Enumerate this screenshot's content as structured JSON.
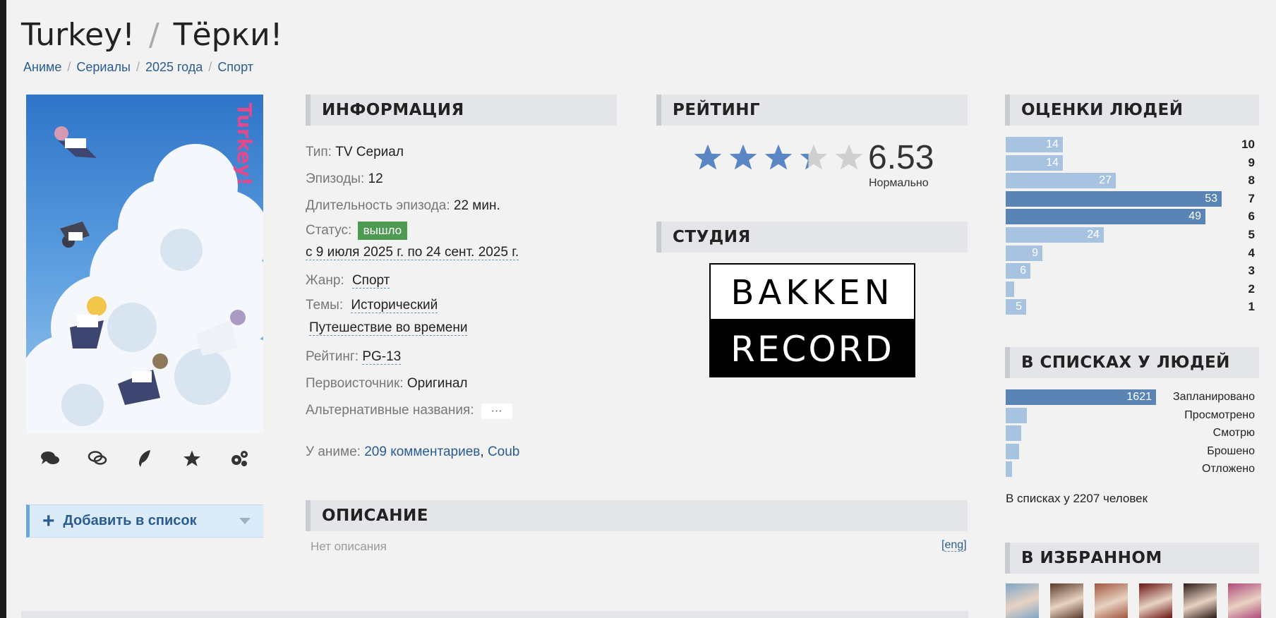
{
  "title": {
    "english": "Turkey!",
    "separator": "/",
    "russian": "Тёрки!"
  },
  "breadcrumbs": [
    "Аниме",
    "Сериалы",
    "2025 года",
    "Спорт"
  ],
  "poster": {
    "alt": "Turkey! poster"
  },
  "poster_actions": [
    "comments-icon",
    "discussion-icon",
    "review-icon",
    "favorite-star-icon",
    "settings-gears-icon"
  ],
  "add_to_list": {
    "plus": "+",
    "label": "Добавить в список"
  },
  "info": {
    "header": "ИНФОРМАЦИЯ",
    "type_key": "Тип:",
    "type_value": "TV Сериал",
    "episodes_key": "Эпизоды:",
    "episodes_value": "12",
    "duration_key": "Длительность эпизода:",
    "duration_value": "22 мин.",
    "status_key": "Статус:",
    "status_value": "вышло",
    "dates": "с 9 июля 2025 г. по 24 сент. 2025 г.",
    "genre_key": "Жанр:",
    "genre_value": "Спорт",
    "themes_key": "Темы:",
    "theme_1": "Исторический",
    "theme_2": "Путешествие во времени",
    "rating_key": "Рейтинг:",
    "rating_value": "PG-13",
    "source_key": "Первоисточник:",
    "source_value": "Оригинал",
    "alt_names_key": "Альтернативные названия:",
    "alt_names_button": "···"
  },
  "rating": {
    "header": "РЕЙТИНГ",
    "score": "6.53",
    "word": "Нормально",
    "stars_filled": 3.3,
    "stars_total": 5
  },
  "studio": {
    "header": "СТУДИЯ",
    "logo_top": "BAKKEN",
    "logo_bottom": "RECORD"
  },
  "people_scores": {
    "header": "ОЦЕНКИ ЛЮДЕЙ",
    "rows": [
      {
        "score": "10",
        "count": "14",
        "value": 14
      },
      {
        "score": "9",
        "count": "14",
        "value": 14
      },
      {
        "score": "8",
        "count": "27",
        "value": 27
      },
      {
        "score": "7",
        "count": "53",
        "value": 53
      },
      {
        "score": "6",
        "count": "49",
        "value": 49
      },
      {
        "score": "5",
        "count": "24",
        "value": 24
      },
      {
        "score": "4",
        "count": "9",
        "value": 9
      },
      {
        "score": "3",
        "count": "6",
        "value": 6
      },
      {
        "score": "2",
        "count": "",
        "value": 2
      },
      {
        "score": "1",
        "count": "5",
        "value": 5
      }
    ],
    "max": 53
  },
  "people_lists": {
    "header": "В СПИСКАХ У ЛЮДЕЙ",
    "rows": [
      {
        "label": "Запланировано",
        "count": "1621",
        "value": 1621
      },
      {
        "label": "Просмотрено",
        "count": "",
        "value": 130
      },
      {
        "label": "Смотрю",
        "count": "",
        "value": 85
      },
      {
        "label": "Брошено",
        "count": "",
        "value": 90
      },
      {
        "label": "Отложено",
        "count": "",
        "value": 40
      }
    ],
    "max": 1621,
    "total": "В списках у 2207 человек"
  },
  "favorites": {
    "header": "В ИЗБРАННОМ",
    "colors": [
      "#7fa6c8",
      "#5a3a2a",
      "#a0563e",
      "#6b1414",
      "#2c1b16",
      "#b04a7a"
    ]
  },
  "comments": {
    "key": "У аниме:",
    "link_1": "209 комментариев",
    "comma": ",",
    "link_2": "Coub"
  },
  "description": {
    "header": "ОПИСАНИЕ",
    "empty": "Нет описания",
    "eng_link": "eng",
    "bracket_open": "[",
    "bracket_close": "]"
  },
  "colors": {
    "link": "#2a5c91",
    "bar_light": "#a7c3e0",
    "bar_dark": "#5a84b3",
    "badge_green": "#4f9a52",
    "star_blue": "#5b86c4",
    "star_grey": "#cfcfcf"
  }
}
